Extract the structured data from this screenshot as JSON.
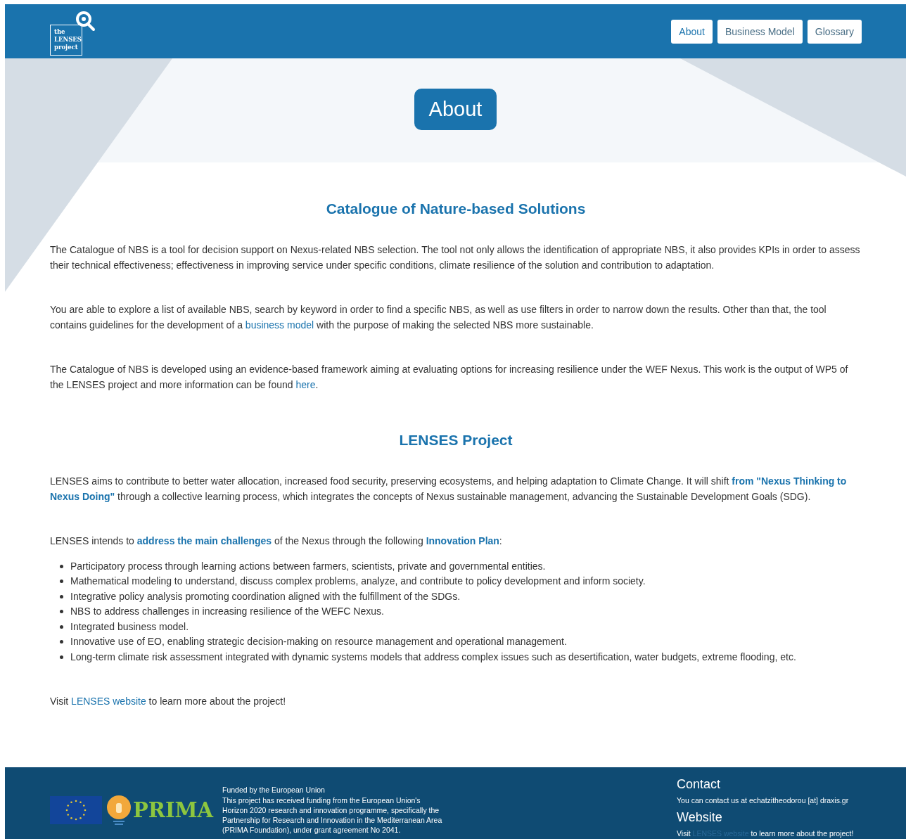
{
  "header": {
    "logo": {
      "lines": [
        "the",
        "LENSES",
        "project"
      ]
    },
    "nav": [
      {
        "label": "About",
        "selected": true
      },
      {
        "label": "Business Model",
        "selected": false
      },
      {
        "label": "Glossary",
        "selected": false
      }
    ]
  },
  "page_title": "About",
  "sections": [
    {
      "heading": "Catalogue of Nature-based Solutions",
      "blocks": [
        {
          "kind": "paragraph",
          "parts": [
            {
              "kind": "text",
              "text": "The Catalogue of NBS is a tool for decision support on Nexus-related NBS selection. The tool not only allows the identification of appropriate NBS, it also provides KPIs in order to assess their technical effectiveness; effectiveness in improving service under specific conditions, climate resilience of the solution and contribution to adaptation."
            }
          ]
        },
        {
          "kind": "paragraph",
          "parts": [
            {
              "kind": "text",
              "text": "You are able to explore a list of available NBS, search by keyword in order to find a specific NBS, as well as use filters in order to narrow down the results. Other than that, the tool contains guidelines for the development of a "
            },
            {
              "kind": "link",
              "text": "business model"
            },
            {
              "kind": "text",
              "text": " with the purpose of making the selected NBS more sustainable."
            }
          ]
        },
        {
          "kind": "paragraph",
          "parts": [
            {
              "kind": "text",
              "text": "The Catalogue of NBS is developed using an evidence-based framework aiming at evaluating options for increasing resilience under the WEF Nexus. This work is the output of WP5 of the LENSES project and more information can be found "
            },
            {
              "kind": "link",
              "text": "here"
            },
            {
              "kind": "text",
              "text": "."
            }
          ]
        }
      ]
    },
    {
      "heading": "LENSES Project",
      "blocks": [
        {
          "kind": "paragraph",
          "parts": [
            {
              "kind": "text",
              "text": "LENSES aims to contribute to better water allocation, increased food security, preserving ecosystems, and helping adaptation to Climate Change. It will shift "
            },
            {
              "kind": "strong",
              "text": "from \"Nexus Thinking to Nexus Doing\""
            },
            {
              "kind": "text",
              "text": " through a collective learning process, which integrates the concepts of Nexus sustainable management, advancing the Sustainable Development Goals (SDG)."
            }
          ]
        },
        {
          "kind": "paragraph",
          "parts": [
            {
              "kind": "text",
              "text": "LENSES intends to "
            },
            {
              "kind": "strong",
              "text": "address the main challenges"
            },
            {
              "kind": "text",
              "text": " of the Nexus through the following "
            },
            {
              "kind": "strong",
              "text": "Innovation Plan"
            },
            {
              "kind": "text",
              "text": ":"
            }
          ]
        },
        {
          "kind": "list",
          "items": [
            "Participatory process through learning actions between farmers, scientists, private and governmental entities.",
            "Mathematical modeling to understand, discuss complex problems, analyze, and contribute to policy development and inform society.",
            "Integrative policy analysis promoting coordination aligned with the fulfillment of the SDGs.",
            "NBS to address challenges in increasing resilience of the WEFC Nexus.",
            "Integrated business model.",
            "Innovative use of EO, enabling strategic decision-making on resource management and operational management.",
            "Long-term climate risk assessment integrated with dynamic systems models that address complex issues such as desertification, water budgets, extreme flooding, etc."
          ]
        },
        {
          "kind": "paragraph",
          "parts": [
            {
              "kind": "text",
              "text": "Visit "
            },
            {
              "kind": "link",
              "text": "LENSES website"
            },
            {
              "kind": "text",
              "text": " to learn more about the project!"
            }
          ]
        }
      ]
    }
  ],
  "footer": {
    "prima_logo": "PRIMA",
    "funding": [
      "Funded by the European Union",
      "This project has received funding from the European Union's Horizon 2020 research and innovation programme, specifically the Partnership for Research and Innovation in the Mediterranean Area (PRIMA Foundation), under grant agreement No 2041."
    ],
    "contact": {
      "heading": "Contact",
      "text": "You can contact us at echatzitheodorou [at] draxis.gr"
    },
    "website": {
      "heading": "Website",
      "parts": [
        {
          "kind": "text",
          "text": "Visit "
        },
        {
          "kind": "link",
          "text": "LENSES website"
        },
        {
          "kind": "text",
          "text": " to learn more about the project!"
        }
      ]
    }
  }
}
